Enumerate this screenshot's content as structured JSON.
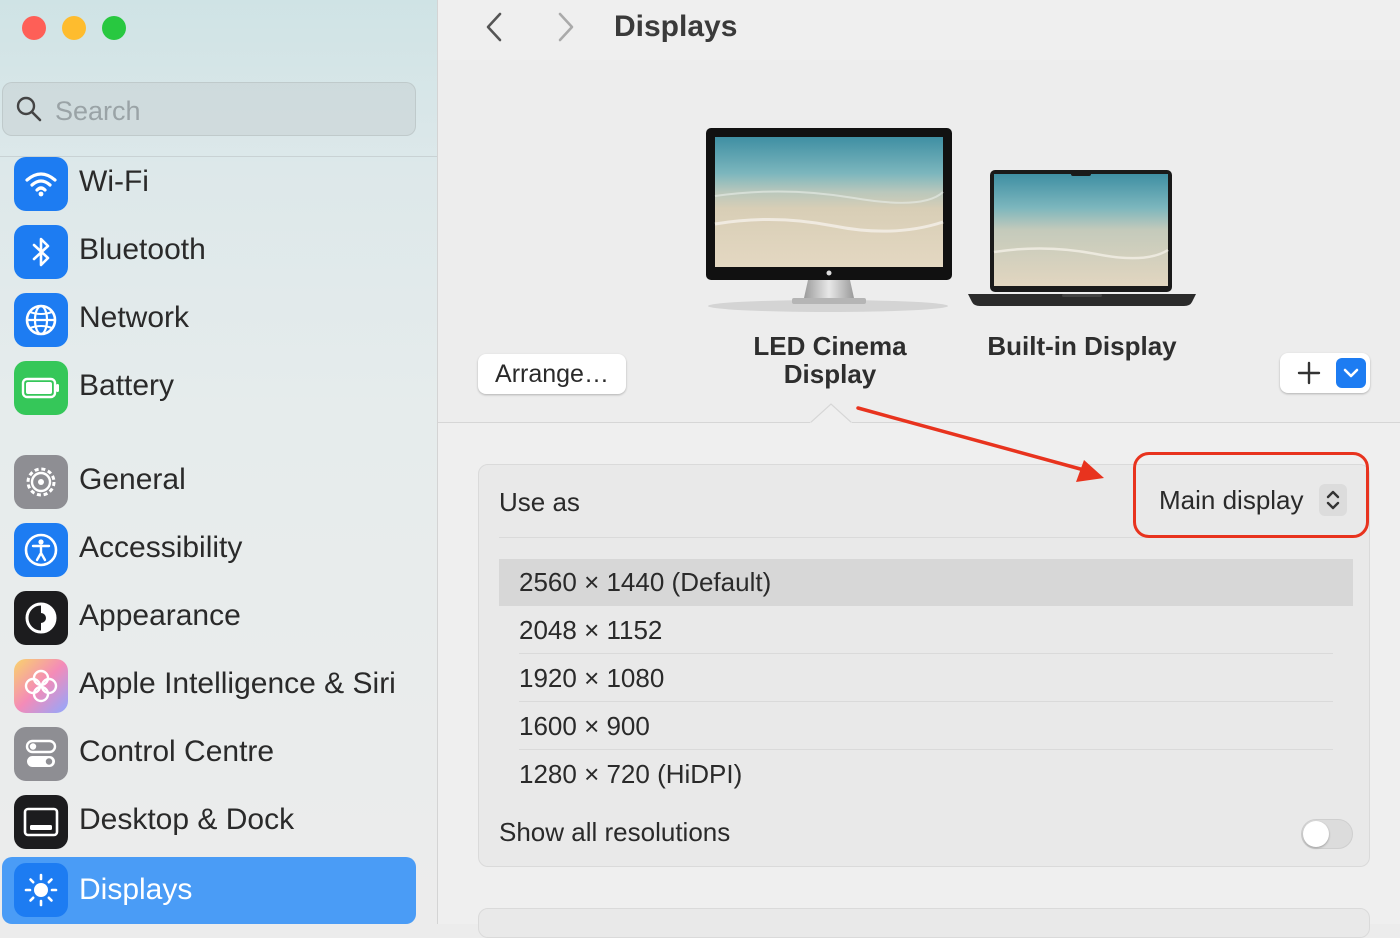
{
  "window": {
    "traffic_lights": [
      "#fe5f57",
      "#febc2e",
      "#28c840"
    ]
  },
  "search": {
    "placeholder": "Search"
  },
  "sidebar": {
    "group1": [
      {
        "label": "Wi-Fi",
        "icon": "wifi-icon",
        "color": "#1d7cf2"
      },
      {
        "label": "Bluetooth",
        "icon": "bluetooth-icon",
        "color": "#1d7cf2"
      },
      {
        "label": "Network",
        "icon": "globe-icon",
        "color": "#1d7cf2"
      },
      {
        "label": "Battery",
        "icon": "battery-icon",
        "color": "#35c759"
      }
    ],
    "group2": [
      {
        "label": "General",
        "icon": "gear-icon",
        "color": "#8e8e93"
      },
      {
        "label": "Accessibility",
        "icon": "accessibility-icon",
        "color": "#1d7cf2"
      },
      {
        "label": "Appearance",
        "icon": "appearance-icon",
        "color": "#1c1c1e"
      },
      {
        "label": "Apple Intelligence & Siri",
        "icon": "siri-icon",
        "color": "#f6a6c8"
      },
      {
        "label": "Control Centre",
        "icon": "control-centre-icon",
        "color": "#8e8e93"
      },
      {
        "label": "Desktop & Dock",
        "icon": "dock-icon",
        "color": "#1c1c1e"
      },
      {
        "label": "Displays",
        "icon": "sun-icon",
        "color": "#1d7cf2",
        "active": true
      }
    ]
  },
  "header": {
    "title": "Displays",
    "back_icon": "chevron-left-icon",
    "forward_icon": "chevron-right-icon"
  },
  "displays": {
    "external": {
      "line1": "LED Cinema",
      "line2": "Display"
    },
    "builtin": {
      "name": "Built-in Display"
    },
    "arrange_label": "Arrange…",
    "add_icon": "plus-icon",
    "menu_icon": "chevron-down-icon"
  },
  "settings": {
    "use_as_label": "Use as",
    "use_as_value": "Main display",
    "resolutions": [
      {
        "label": "2560 × 1440 (Default)",
        "selected": true
      },
      {
        "label": "2048 × 1152",
        "selected": false
      },
      {
        "label": "1920 × 1080",
        "selected": false
      },
      {
        "label": "1600 × 900",
        "selected": false
      },
      {
        "label": "1280 × 720 (HiDPI)",
        "selected": false
      }
    ],
    "show_all_label": "Show all resolutions",
    "show_all_enabled": false
  },
  "annotation": {
    "color": "#e8331e"
  }
}
